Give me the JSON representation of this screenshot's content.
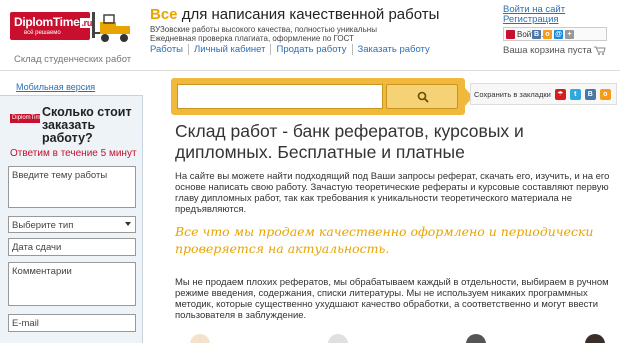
{
  "header": {
    "logo_text": "DiplomTime",
    "logo_domain": ".ru",
    "logo_tagline": "всё решаемо",
    "headline_accent": "Все",
    "headline_rest": " для написания качественной работы",
    "sub_lines": [
      "ВУЗовские работы высокого качества, полностью уникальны",
      "Ежедневная проверка плагиата, оформление по ГОСТ"
    ],
    "login_link": "Войти на сайт",
    "register_link": "Регистрация",
    "social_login_label": "Войти...",
    "cart_text": "Ваша корзина пуста"
  },
  "nav": {
    "items": [
      "Работы",
      "Личный кабинет",
      "Продать работу",
      "Заказать работу"
    ]
  },
  "breadcrumb": "Склад студенческих работ",
  "sidebar": {
    "mobile_link": "Мобильная версия",
    "mini_logo": "DiplomTime",
    "title": "Сколько стоит заказать работу?",
    "answer": "Ответим в течение 5 минут",
    "topic_placeholder": "Введите тему работы",
    "type_select": "Выберите тип",
    "date_placeholder": "Дата сдачи",
    "comments_placeholder": "Комментарии",
    "email_placeholder": "E-mail"
  },
  "search": {
    "placeholder": ""
  },
  "bookmarks": {
    "label": "Сохранить в закладки"
  },
  "main": {
    "title": "Склад работ - банк рефератов, курсовых и дипломных. Бесплатные и платные",
    "paragraph1": "На сайте вы можете найти подходящий под Ваши запросы реферат, скачать его, изучить, и на его основе написать свою работу. Зачастую теоретические рефераты и курсовые составляют первую главу дипломных работ, так как требования к уникальности теоретического материала не предъявляются.",
    "quote": "Все что мы продаем качественно оформлено и периодически проверяется на актуальность.",
    "paragraph2": "Мы не продаем плохих рефератов, мы обрабатываем каждый в отдельности, выбираем в ручном режиме введения, содержания, списки литературы. Мы не используем никаких программных методик, которые существенно ухудшают качество обработки, а соответственно и могут ввести пользователя в заблуждение."
  },
  "colors": {
    "brand_red": "#c8102e",
    "accent_yellow": "#e8a400",
    "link_blue": "#2d6fb5"
  }
}
